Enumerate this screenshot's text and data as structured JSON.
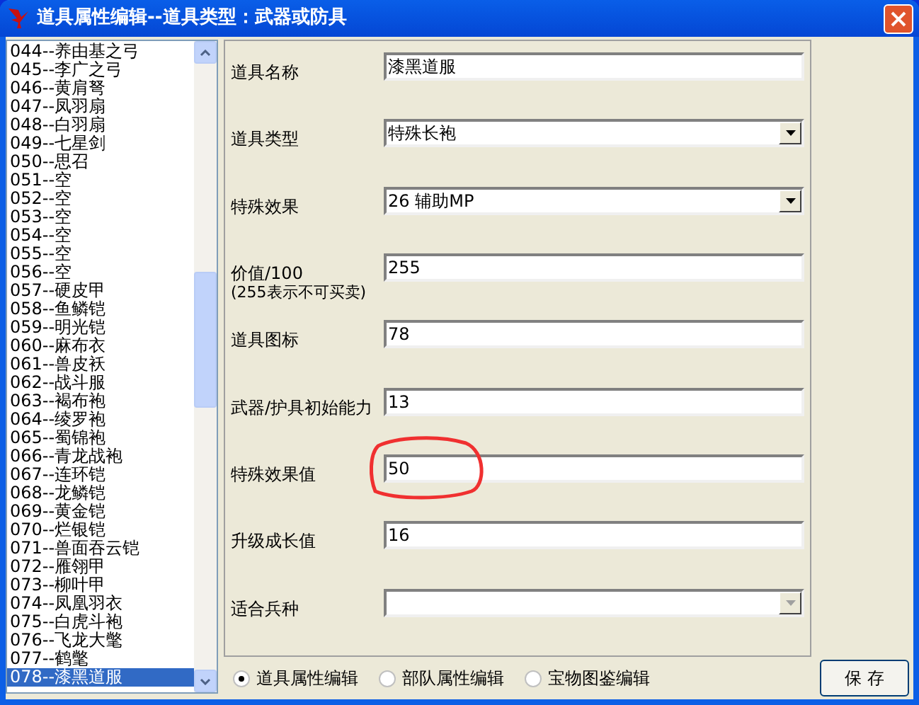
{
  "window": {
    "title": "道具属性编辑--道具类型：武器或防具"
  },
  "items": [
    {
      "label": "044--养由基之弓",
      "selected": false
    },
    {
      "label": "045--李广之弓",
      "selected": false
    },
    {
      "label": "046--黄肩弩",
      "selected": false
    },
    {
      "label": "047--凤羽扇",
      "selected": false
    },
    {
      "label": "048--白羽扇",
      "selected": false
    },
    {
      "label": "049--七星剑",
      "selected": false
    },
    {
      "label": "050--思召",
      "selected": false
    },
    {
      "label": "051--空",
      "selected": false
    },
    {
      "label": "052--空",
      "selected": false
    },
    {
      "label": "053--空",
      "selected": false
    },
    {
      "label": "054--空",
      "selected": false
    },
    {
      "label": "055--空",
      "selected": false
    },
    {
      "label": "056--空",
      "selected": false
    },
    {
      "label": "057--硬皮甲",
      "selected": false
    },
    {
      "label": "058--鱼鳞铠",
      "selected": false
    },
    {
      "label": "059--明光铠",
      "selected": false
    },
    {
      "label": "060--麻布衣",
      "selected": false
    },
    {
      "label": "061--兽皮袄",
      "selected": false
    },
    {
      "label": "062--战斗服",
      "selected": false
    },
    {
      "label": "063--褐布袍",
      "selected": false
    },
    {
      "label": "064--绫罗袍",
      "selected": false
    },
    {
      "label": "065--蜀锦袍",
      "selected": false
    },
    {
      "label": "066--青龙战袍",
      "selected": false
    },
    {
      "label": "067--连环铠",
      "selected": false
    },
    {
      "label": "068--龙鳞铠",
      "selected": false
    },
    {
      "label": "069--黄金铠",
      "selected": false
    },
    {
      "label": "070--烂银铠",
      "selected": false
    },
    {
      "label": "071--兽面吞云铠",
      "selected": false
    },
    {
      "label": "072--雁翎甲",
      "selected": false
    },
    {
      "label": "073--柳叶甲",
      "selected": false
    },
    {
      "label": "074--凤凰羽衣",
      "selected": false
    },
    {
      "label": "075--白虎斗袍",
      "selected": false
    },
    {
      "label": "076--飞龙大氅",
      "selected": false
    },
    {
      "label": "077--鹤氅",
      "selected": false
    },
    {
      "label": "078--漆黑道服",
      "selected": true
    }
  ],
  "fields": [
    {
      "kind": "text",
      "label": "道具名称",
      "value": "漆黑道服",
      "circled": false
    },
    {
      "kind": "select",
      "label": "道具类型",
      "value": "特殊长袍",
      "disabled": false,
      "circled": false
    },
    {
      "kind": "select",
      "label": "特殊效果",
      "value": "26 辅助MP",
      "disabled": false,
      "circled": false
    },
    {
      "kind": "text",
      "label": "价值/100",
      "note": "(255表示不可买卖)",
      "value": "255",
      "circled": false
    },
    {
      "kind": "text",
      "label": "道具图标",
      "value": "78",
      "circled": false
    },
    {
      "kind": "text",
      "label": "武器/护具初始能力",
      "value": "13",
      "circled": false
    },
    {
      "kind": "text",
      "label": "特殊效果值",
      "value": "50",
      "circled": true
    },
    {
      "kind": "text",
      "label": "升级成长值",
      "value": "16",
      "circled": false
    },
    {
      "kind": "select",
      "label": "适合兵种",
      "disabled": true,
      "circled": false
    }
  ],
  "modes": [
    {
      "label": "道具属性编辑",
      "selected": true
    },
    {
      "label": "部队属性编辑",
      "selected": false
    },
    {
      "label": "宝物图鉴编辑",
      "selected": false
    }
  ],
  "save_button": "保 存"
}
